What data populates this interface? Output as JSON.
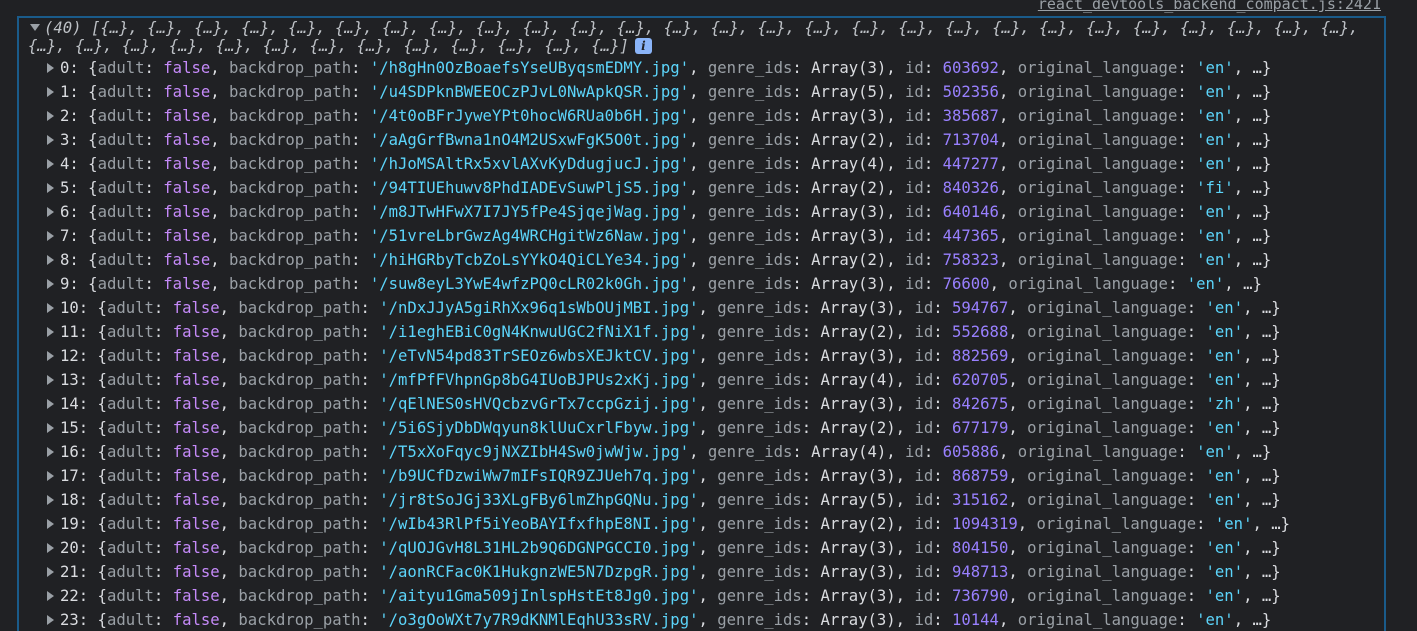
{
  "source_link": "react_devtools_backend_compact.js:2421",
  "summary": {
    "line1": "(40) [{…}, {…}, {…}, {…}, {…}, {…}, {…}, {…}, {…}, {…}, {…}, {…}, {…}, {…}, {…}, {…}, {…}, {…}, {…}, {…}, {…}, {…}, {…}, {…}, {…}, {…}, {…},",
    "line2": "{…}, {…}, {…}, {…}, {…}, {…}, {…}, {…}, {…}, {…}, {…}, {…}, {…}]",
    "info_glyph": "i"
  },
  "labels": {
    "adult": "adult",
    "false": "false",
    "backdrop_path": "backdrop_path",
    "genre_ids": "genre_ids",
    "id": "id",
    "original_language": "original_language",
    "ellipsis": "…"
  },
  "rows": [
    {
      "index": "0",
      "backdrop": "/h8gHn0OzBoaefsYseUByqsmEDMY.jpg",
      "genres": "Array(3)",
      "id": "603692",
      "lang": "en"
    },
    {
      "index": "1",
      "backdrop": "/u4SDPknBWEEOCzPJvL0NwApkQSR.jpg",
      "genres": "Array(5)",
      "id": "502356",
      "lang": "en"
    },
    {
      "index": "2",
      "backdrop": "/4t0oBFrJyweYPt0hocW6RUa0b6H.jpg",
      "genres": "Array(3)",
      "id": "385687",
      "lang": "en"
    },
    {
      "index": "3",
      "backdrop": "/aAgGrfBwna1nO4M2USxwFgK5O0t.jpg",
      "genres": "Array(2)",
      "id": "713704",
      "lang": "en"
    },
    {
      "index": "4",
      "backdrop": "/hJoMSAltRx5xvlAXvKyDdugjucJ.jpg",
      "genres": "Array(4)",
      "id": "447277",
      "lang": "en"
    },
    {
      "index": "5",
      "backdrop": "/94TIUEhuwv8PhdIADEvSuwPljS5.jpg",
      "genres": "Array(2)",
      "id": "840326",
      "lang": "fi"
    },
    {
      "index": "6",
      "backdrop": "/m8JTwHFwX7I7JY5fPe4SjqejWag.jpg",
      "genres": "Array(3)",
      "id": "640146",
      "lang": "en"
    },
    {
      "index": "7",
      "backdrop": "/51vreLbrGwzAg4WRCHgitWz6Naw.jpg",
      "genres": "Array(3)",
      "id": "447365",
      "lang": "en"
    },
    {
      "index": "8",
      "backdrop": "/hiHGRbyTcbZoLsYYkO4QiCLYe34.jpg",
      "genres": "Array(2)",
      "id": "758323",
      "lang": "en"
    },
    {
      "index": "9",
      "backdrop": "/suw8eyL3YwE4wfzPQ0cLR02k0Gh.jpg",
      "genres": "Array(3)",
      "id": "76600",
      "lang": "en"
    },
    {
      "index": "10",
      "backdrop": "/nDxJJyA5giRhXx96q1sWbOUjMBI.jpg",
      "genres": "Array(3)",
      "id": "594767",
      "lang": "en"
    },
    {
      "index": "11",
      "backdrop": "/i1eghEBiC0gN4KnwuUGC2fNiX1f.jpg",
      "genres": "Array(2)",
      "id": "552688",
      "lang": "en"
    },
    {
      "index": "12",
      "backdrop": "/eTvN54pd83TrSEOz6wbsXEJktCV.jpg",
      "genres": "Array(3)",
      "id": "882569",
      "lang": "en"
    },
    {
      "index": "13",
      "backdrop": "/mfPfFVhpnGp8bG4IUoBJPUs2xKj.jpg",
      "genres": "Array(4)",
      "id": "620705",
      "lang": "en"
    },
    {
      "index": "14",
      "backdrop": "/qElNES0sHVQcbzvGrTx7ccpGzij.jpg",
      "genres": "Array(3)",
      "id": "842675",
      "lang": "zh"
    },
    {
      "index": "15",
      "backdrop": "/5i6SjyDbDWqyun8klUuCxrlFbyw.jpg",
      "genres": "Array(2)",
      "id": "677179",
      "lang": "en"
    },
    {
      "index": "16",
      "backdrop": "/T5xXoFqyc9jNXZIbH4Sw0jwWjw.jpg",
      "genres": "Array(4)",
      "id": "605886",
      "lang": "en"
    },
    {
      "index": "17",
      "backdrop": "/b9UCfDzwiWw7mIFsIQR9ZJUeh7q.jpg",
      "genres": "Array(3)",
      "id": "868759",
      "lang": "en"
    },
    {
      "index": "18",
      "backdrop": "/jr8tSoJGj33XLgFBy6lmZhpGQNu.jpg",
      "genres": "Array(5)",
      "id": "315162",
      "lang": "en"
    },
    {
      "index": "19",
      "backdrop": "/wIb43RlPf5iYeoBAYIfxfhpE8NI.jpg",
      "genres": "Array(2)",
      "id": "1094319",
      "lang": "en"
    },
    {
      "index": "20",
      "backdrop": "/qUOJGvH8L31HL2b9Q6DGNPGCCI0.jpg",
      "genres": "Array(3)",
      "id": "804150",
      "lang": "en"
    },
    {
      "index": "21",
      "backdrop": "/aonRCFac0K1HukgnzWE5N7DzpgR.jpg",
      "genres": "Array(3)",
      "id": "948713",
      "lang": "en"
    },
    {
      "index": "22",
      "backdrop": "/aityu1Gma509jInlspHstEt8Jg0.jpg",
      "genres": "Array(3)",
      "id": "736790",
      "lang": "en"
    },
    {
      "index": "23",
      "backdrop": "/o3gOoWXt7y7R9dKNMlEqhU33sRV.jpg",
      "genres": "Array(3)",
      "id": "10144",
      "lang": "en"
    }
  ]
}
